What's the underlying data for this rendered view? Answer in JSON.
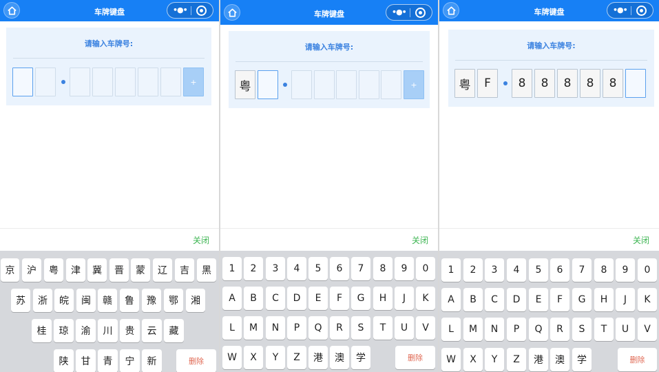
{
  "nav": {
    "title": "车牌键盘",
    "more_icon": "more-dots-icon",
    "target_icon": "target-icon",
    "home_icon": "home-icon"
  },
  "card_title": "请输入车牌号:",
  "new_energy_label": "+",
  "close_label": "关闭",
  "delete_label": "删除",
  "panels": [
    {
      "plate": [
        "",
        "",
        "",
        "",
        "",
        "",
        "",
        ""
      ],
      "active_slot": 0
    },
    {
      "plate": [
        "粤",
        "",
        "",
        "",
        "",
        "",
        "",
        ""
      ],
      "active_slot": 1
    },
    {
      "plate": [
        "粤",
        "F",
        "8",
        "8",
        "8",
        "8",
        "8",
        ""
      ],
      "active_slot": 7
    }
  ],
  "province_keys": [
    [
      "京",
      "沪",
      "粤",
      "津",
      "冀",
      "晋",
      "蒙",
      "辽",
      "吉",
      "黑"
    ],
    [
      "苏",
      "浙",
      "皖",
      "闽",
      "赣",
      "鲁",
      "豫",
      "鄂",
      "湘"
    ],
    [
      "桂",
      "琼",
      "渝",
      "川",
      "贵",
      "云",
      "藏"
    ],
    [
      "陕",
      "甘",
      "青",
      "宁",
      "新"
    ]
  ],
  "alnum_keys": [
    [
      "1",
      "2",
      "3",
      "4",
      "5",
      "6",
      "7",
      "8",
      "9",
      "0"
    ],
    [
      "A",
      "B",
      "C",
      "D",
      "E",
      "F",
      "G",
      "H",
      "J",
      "K"
    ],
    [
      "L",
      "M",
      "N",
      "P",
      "Q",
      "R",
      "S",
      "T",
      "U",
      "V"
    ],
    [
      "W",
      "X",
      "Y",
      "Z",
      "港",
      "澳",
      "学"
    ]
  ],
  "colors": {
    "nav_blue": "#1780f5",
    "accent": "#3b82e0",
    "close_green": "#3db552",
    "delete_red": "#e06a55"
  }
}
